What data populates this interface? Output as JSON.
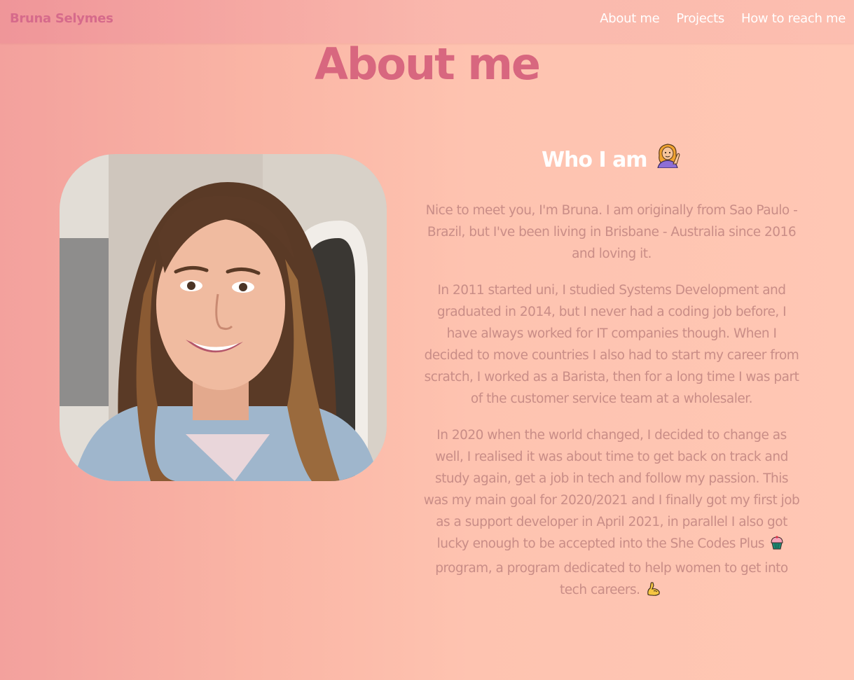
{
  "navbar": {
    "brand": "Bruna Selymes",
    "links": [
      {
        "label": "About me"
      },
      {
        "label": "Projects"
      },
      {
        "label": "How to reach me"
      }
    ]
  },
  "page": {
    "title": "About me"
  },
  "about": {
    "heading": "Who I am",
    "heading_icon": "woman-tipping-hand-emoji",
    "paragraph_1": "Nice to meet you, I'm Bruna. I am originally from Sao Paulo - Brazil, but I've been living in Brisbane - Australia since 2016 and loving it.",
    "paragraph_2": "In 2011 started uni, I studied Systems Development and graduated in 2014, but I never had a coding job before, I have always worked for IT companies though. When I decided to move countries I also had to start my career from scratch, I worked as a Barista, then for a long time I was part of the customer service team at a wholesaler.",
    "paragraph_3_part1": "In 2020 when the world changed, I decided to change as well, I realised it was about time to get back on track and study again, get a job in tech and follow my passion. This was my main goal for 2020/2021 and I finally got my first job as a support developer in April 2021, in parallel I also got lucky enough to be accepted into the She Codes Plus",
    "paragraph_3_part2": "program, a program dedicated to help women to get into tech careers.",
    "inline_icons": [
      "cupcake-emoji",
      "flexed-biceps-emoji"
    ]
  },
  "colors": {
    "title_pink": "#d8677f",
    "brand_pink": "#d66a8b",
    "body_text": "#c98d87",
    "nav_text": "#ffffff",
    "background_left": "#f3a19d",
    "background_right": "#ffc7b4"
  }
}
